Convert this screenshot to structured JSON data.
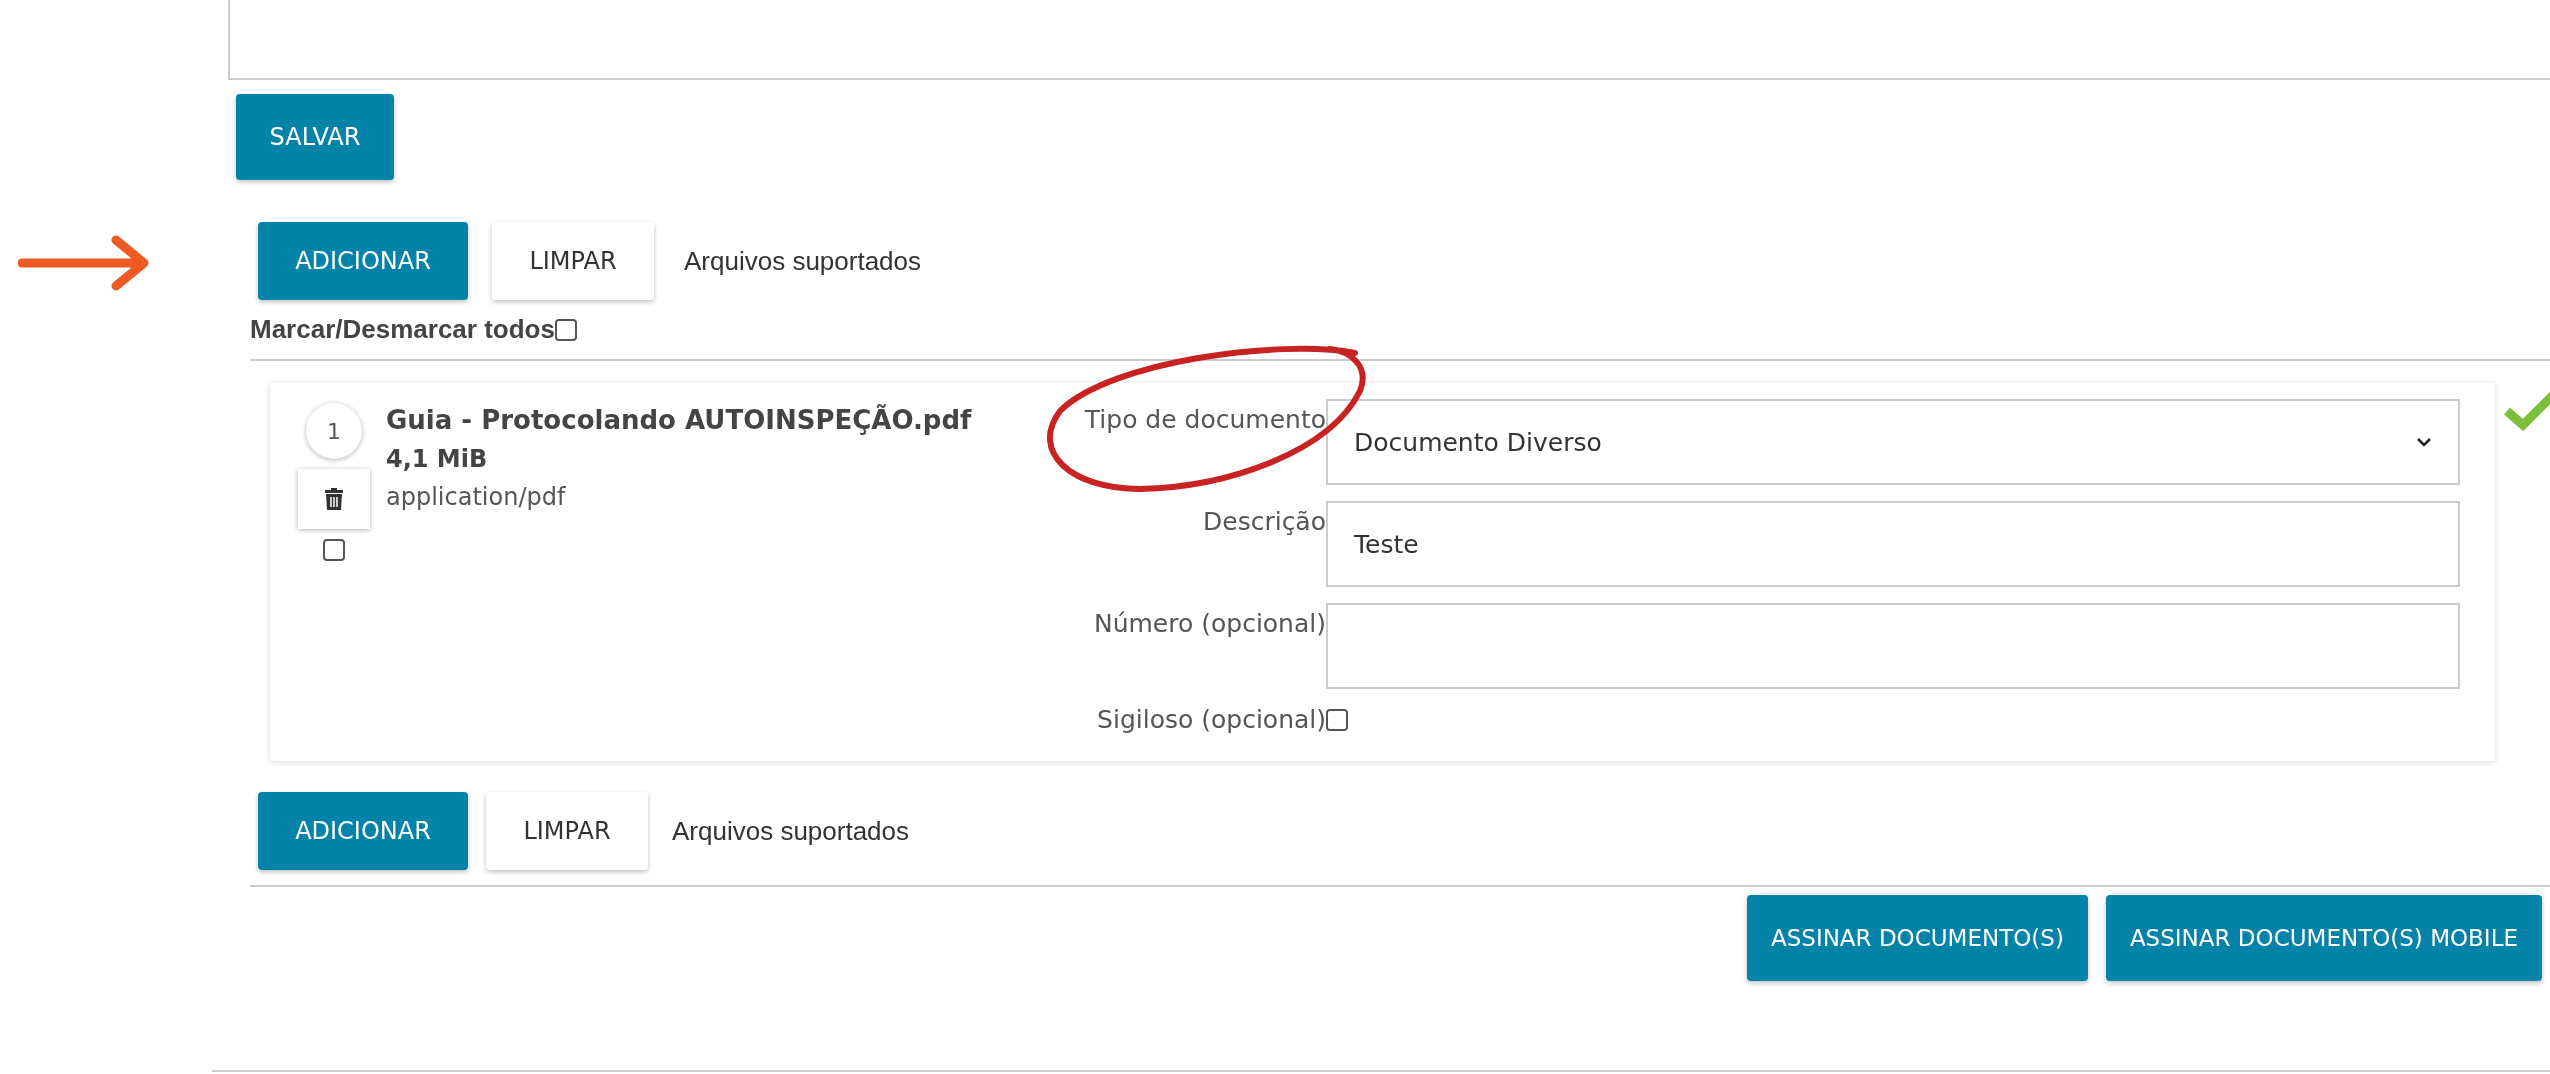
{
  "save_button": "SALVAR",
  "upload_toolbars": [
    {
      "add_label": "ADICIONAR",
      "clear_label": "LIMPAR",
      "supported_link": "Arquivos suportados"
    },
    {
      "add_label": "ADICIONAR",
      "clear_label": "LIMPAR",
      "supported_link": "Arquivos suportados"
    }
  ],
  "select_all": {
    "label": "Marcar/Desmarcar todos",
    "checked": false
  },
  "files": [
    {
      "index": "1",
      "name": "Guia - Protocolando AUTOINSPEÇÃO.pdf",
      "size": "4,1 MiB",
      "mime": "application/pdf",
      "checked": false,
      "valid": true,
      "fields": [
        {
          "kind": "select",
          "label": "Tipo de documento",
          "value": "Documento Diverso"
        },
        {
          "kind": "text",
          "label": "Descrição",
          "value": "Teste"
        },
        {
          "kind": "text",
          "label": "Número (opcional)"
        },
        {
          "kind": "checkbox",
          "label": "Sigiloso (opcional)",
          "checked": false
        }
      ]
    }
  ],
  "sign_buttons": [
    "ASSINAR DOCUMENTO(S)",
    "ASSINAR DOCUMENTO(S) MOBILE"
  ]
}
